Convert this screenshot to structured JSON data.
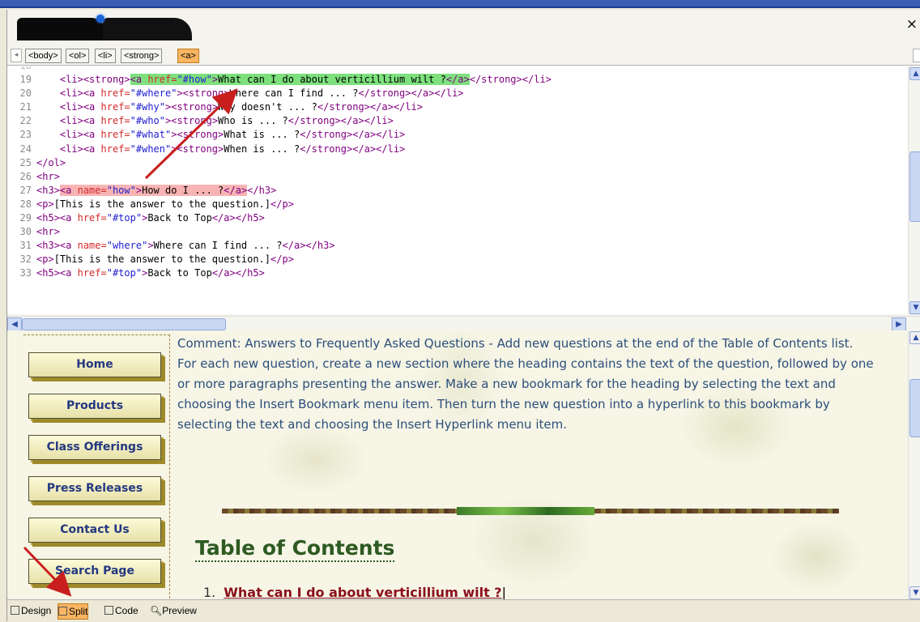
{
  "window": {
    "close_label": "×"
  },
  "tag_selector": {
    "tags": [
      "<body>",
      "<ol>",
      "<li>",
      "<strong>",
      "<a>"
    ],
    "active": "<a>"
  },
  "code_view": {
    "first_line_number": "19",
    "lines": [
      {
        "n": "19",
        "text": "    <li><strong><a href=\"#how\">What can I do about verticillium wilt ?</a></strong></li>"
      },
      {
        "n": "20",
        "text": "    <li><a href=\"#where\"><strong>Where can I find ... ?</strong></a></li>"
      },
      {
        "n": "21",
        "text": "    <li><a href=\"#why\"><strong>Why doesn't ... ?</strong></a></li>"
      },
      {
        "n": "22",
        "text": "    <li><a href=\"#who\"><strong>Who is ... ?</strong></a></li>"
      },
      {
        "n": "23",
        "text": "    <li><a href=\"#what\"><strong>What is ... ?</strong></a></li>"
      },
      {
        "n": "24",
        "text": "    <li><a href=\"#when\"><strong>When is ... ?</strong></a></li>"
      },
      {
        "n": "25",
        "text": "</ol>"
      },
      {
        "n": "26",
        "text": "<hr>"
      },
      {
        "n": "27",
        "text": "<h3><a name=\"how\">How do I ... ?</a></h3>"
      },
      {
        "n": "28",
        "text": "<p>[This is the answer to the question.]</p>"
      },
      {
        "n": "29",
        "text": "<h5><a href=\"#top\">Back to Top</a></h5>"
      },
      {
        "n": "30",
        "text": "<hr>"
      },
      {
        "n": "31",
        "text": "<h3><a name=\"where\">Where can I find ... ?</a></h3>"
      },
      {
        "n": "32",
        "text": "<p>[This is the answer to the question.]</p>"
      },
      {
        "n": "33",
        "text": "<h5><a href=\"#top\">Back to Top</a></h5>"
      }
    ]
  },
  "design_view": {
    "nav_buttons": [
      "Home",
      "Products",
      "Class Offerings",
      "Press Releases",
      "Contact Us",
      "Search Page"
    ],
    "comment": "Comment: Answers to Frequently Asked Questions - Add new questions at the end of the Table of Contents list. For each new question, create a new section where the heading contains the text of the question, followed by one or more paragraphs presenting the answer. Make a new bookmark for the heading by selecting the text and choosing the Insert Bookmark menu item. Then turn the new question into a hyperlink to this bookmark by selecting the text and choosing the Insert Hyperlink menu item.",
    "toc_title": "Table of Contents",
    "toc_items": [
      {
        "num": "1.",
        "text": "What can I do about verticillium wilt ?"
      }
    ]
  },
  "view_tabs": [
    {
      "label": "Design",
      "icon": "design-icon"
    },
    {
      "label": "Split",
      "icon": "split-icon",
      "active": true
    },
    {
      "label": "Code",
      "icon": "code-icon"
    },
    {
      "label": "Preview",
      "icon": "preview-icon"
    }
  ],
  "colors": {
    "tag": "#800080",
    "attr": "#d22a2a",
    "value": "#2020d0",
    "highlight_green": "#7de07d",
    "highlight_red": "#f8b4b4",
    "active_tab": "#f8b562",
    "arrow": "#c81e1e"
  }
}
